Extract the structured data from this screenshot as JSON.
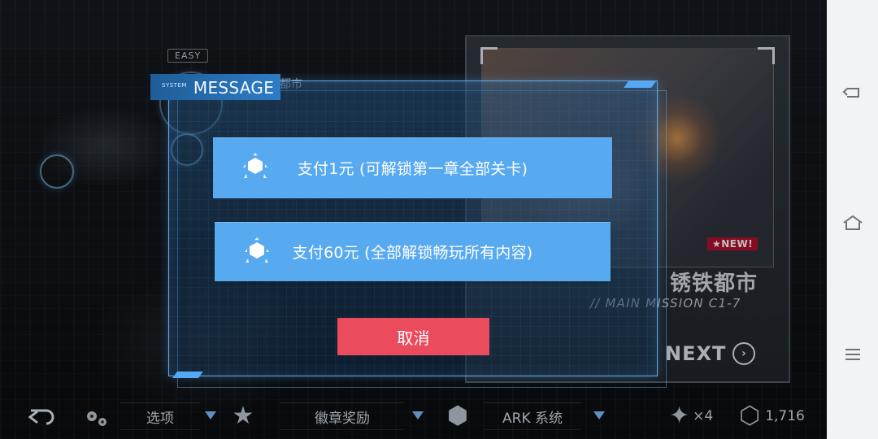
{
  "background": {
    "difficulty_tag": "EASY",
    "city_label": "都市",
    "level_card": {
      "badge": "★NEW!",
      "title": "锈铁都市",
      "subtitle": "// MAIN MISSION C1-7",
      "next_label": "NEXT"
    }
  },
  "modal": {
    "system_label": "SYSTEM",
    "title": "MESSAGE",
    "options": [
      {
        "label": "支付1元 (可解锁第一章全部关卡)",
        "icon": "cube-icon"
      },
      {
        "label": "支付60元 (全部解锁畅玩所有内容)",
        "icon": "cube-icon"
      }
    ],
    "cancel_label": "取消"
  },
  "bottom_menu": {
    "options_label": "选项",
    "medals_label": "徽章奖励",
    "ark_label": "ARK 系统",
    "badge_count": "×4",
    "coin_count": "1,716"
  },
  "android_nav": {
    "back_icon": "back-icon",
    "home_icon": "home-icon",
    "menu_icon": "menu-icon"
  },
  "colors": {
    "modal_accent": "#57a9f0",
    "modal_header": "#2e7cc4",
    "cancel_red": "#ea4b5d",
    "nav_bg": "#f2f3f5"
  }
}
